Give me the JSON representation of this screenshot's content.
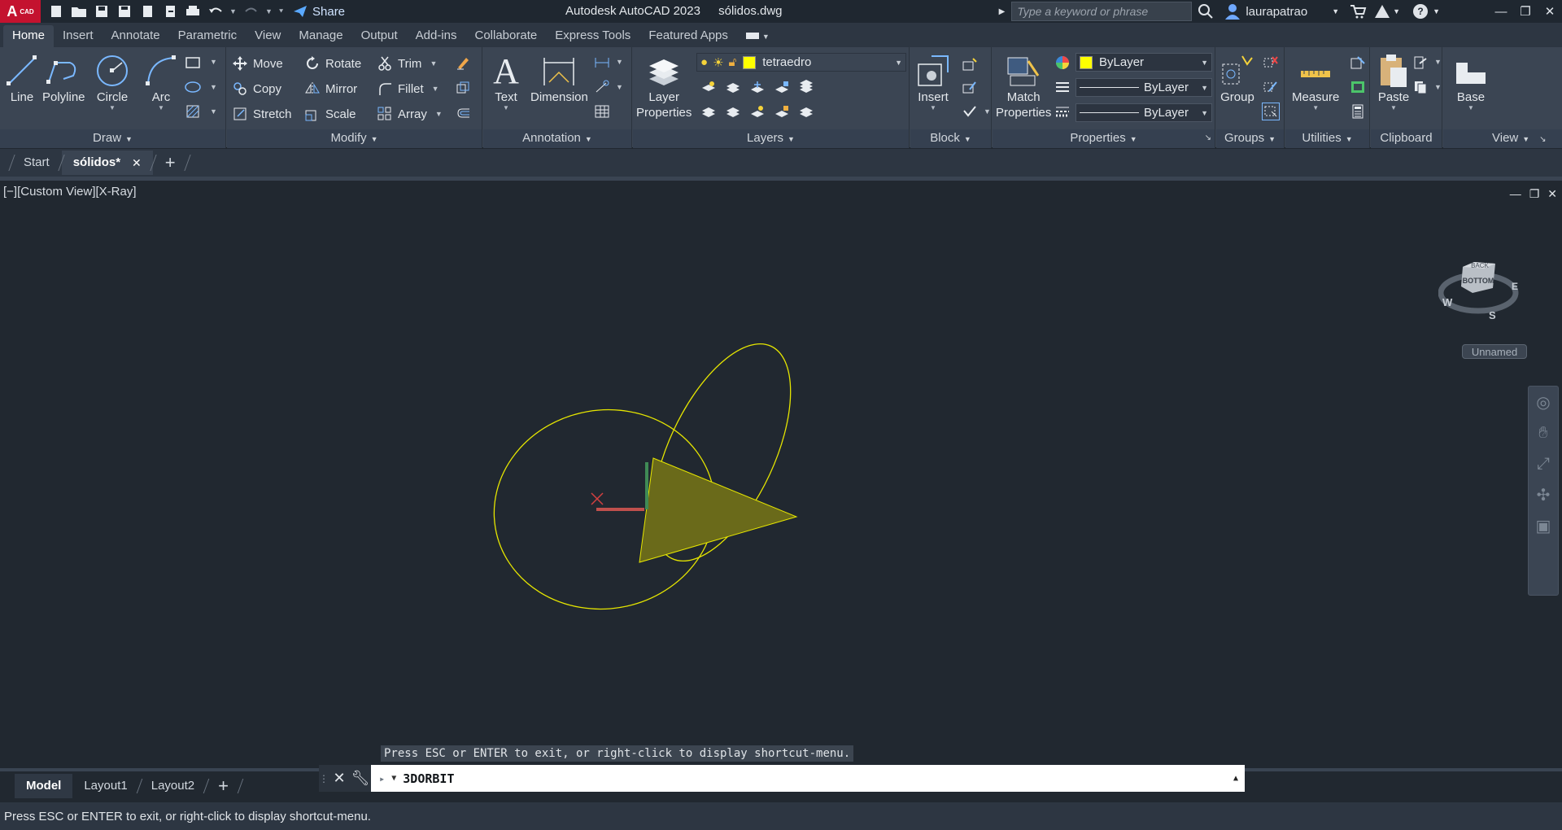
{
  "app": {
    "logo_letter": "A",
    "logo_text": "CAD",
    "title": "Autodesk AutoCAD 2023",
    "document": "sólidos.dwg",
    "share_label": "Share",
    "search_placeholder": "Type a keyword or phrase",
    "user": "laurapatrao"
  },
  "ribbon_tabs": [
    "Home",
    "Insert",
    "Annotate",
    "Parametric",
    "View",
    "Manage",
    "Output",
    "Add-ins",
    "Collaborate",
    "Express Tools",
    "Featured Apps"
  ],
  "panels": {
    "draw": {
      "title": "Draw",
      "line": "Line",
      "polyline": "Polyline",
      "circle": "Circle",
      "arc": "Arc"
    },
    "modify": {
      "title": "Modify",
      "move": "Move",
      "rotate": "Rotate",
      "trim": "Trim",
      "copy": "Copy",
      "mirror": "Mirror",
      "fillet": "Fillet",
      "stretch": "Stretch",
      "scale": "Scale",
      "array": "Array"
    },
    "annotation": {
      "title": "Annotation",
      "text": "Text",
      "dimension": "Dimension"
    },
    "layers": {
      "title": "Layers",
      "layer_properties_1": "Layer",
      "layer_properties_2": "Properties",
      "current_layer": "tetraedro"
    },
    "block": {
      "title": "Block",
      "insert": "Insert"
    },
    "properties": {
      "title": "Properties",
      "match_1": "Match",
      "match_2": "Properties",
      "color": "ByLayer",
      "linetype": "ByLayer",
      "lineweight": "ByLayer"
    },
    "groups": {
      "title": "Groups",
      "group": "Group"
    },
    "utilities": {
      "title": "Utilities",
      "measure": "Measure"
    },
    "clipboard": {
      "title": "Clipboard",
      "paste": "Paste"
    },
    "view": {
      "title": "View",
      "base": "Base"
    }
  },
  "file_tabs": {
    "start": "Start",
    "active": "sólidos*"
  },
  "viewport": {
    "label": "[−][Custom View][X-Ray]",
    "viewcube_top": "BACK",
    "viewcube_face": "BOTTOM",
    "compass": {
      "w": "W",
      "s": "S",
      "e": "E"
    },
    "named_view": "Unnamed",
    "prompt_tip": "Press ESC or ENTER to exit, or right-click to display shortcut-menu."
  },
  "command": {
    "current": "3DORBIT"
  },
  "layout_tabs": [
    "Model",
    "Layout1",
    "Layout2"
  ],
  "status_text": "Press ESC or ENTER to exit, or right-click to display shortcut-menu."
}
